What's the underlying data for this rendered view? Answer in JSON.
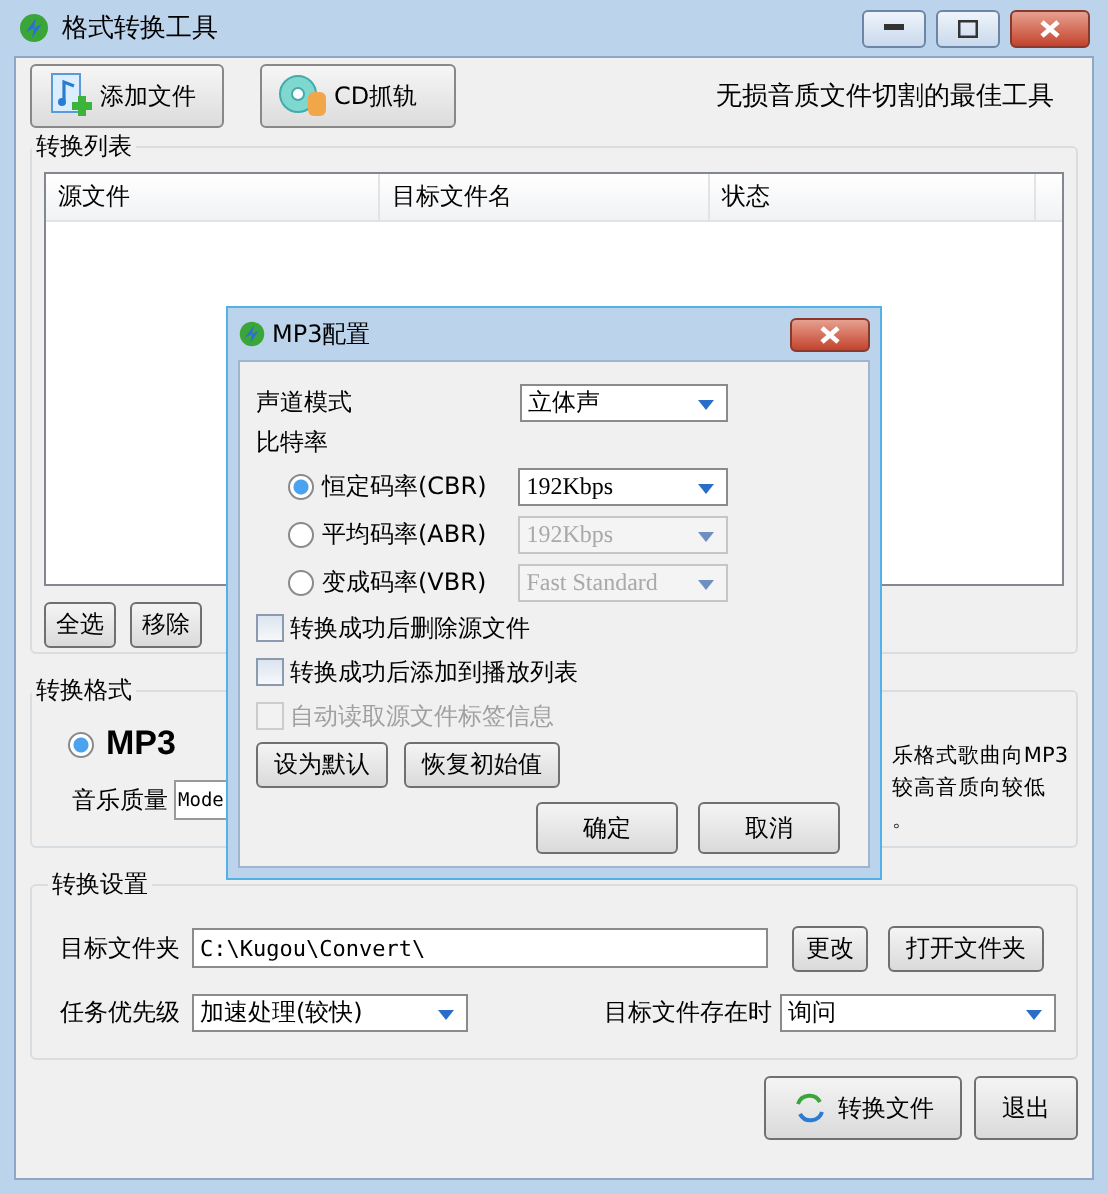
{
  "window": {
    "title": "格式转换工具"
  },
  "toolbar": {
    "buttons": [
      {
        "label": "添加文件",
        "kind": "add-file"
      },
      {
        "label": "CD抓轨",
        "kind": "cd"
      }
    ],
    "slogan": "无损音质文件切割的最佳工具"
  },
  "convert_list": {
    "title": "转换列表",
    "columns": [
      "源文件",
      "目标文件名",
      "状态"
    ],
    "buttons": [
      "全选",
      "移除"
    ]
  },
  "format": {
    "title": "转换格式",
    "options": [
      {
        "label": "MP3",
        "selected": true
      }
    ],
    "quality_label": "音乐质量",
    "quality_value": "Mode",
    "description": [
      "乐格式歌曲向MP3",
      "较高音质向较低",
      "。"
    ]
  },
  "settings": {
    "title": "转换设置",
    "folder_label": "目标文件夹",
    "folder_value": "C:\\Kugou\\Convert\\",
    "folder_buttons": [
      "更改",
      "打开文件夹"
    ],
    "priority_label": "任务优先级",
    "priority_value": "加速处理(较快)",
    "exists_label": "目标文件存在时",
    "exists_value": "询问"
  },
  "actions": [
    {
      "label": "转换文件",
      "kind": "convert"
    },
    {
      "label": "退出",
      "kind": "plain"
    }
  ],
  "dialog": {
    "title": "MP3配置",
    "channel_label": "声道模式",
    "channel_value": "立体声",
    "bitrate_label": "比特率",
    "modes": [
      {
        "label": "恒定码率(CBR)",
        "selected": true,
        "value": "192Kbps",
        "disabled": false
      },
      {
        "label": "平均码率(ABR)",
        "selected": false,
        "value": "192Kbps",
        "disabled": true
      },
      {
        "label": "变成码率(VBR)",
        "selected": false,
        "value": "Fast Standard",
        "disabled": true
      }
    ],
    "options": [
      {
        "label": "转换成功后删除源文件",
        "checked": false,
        "disabled": false
      },
      {
        "label": "转换成功后添加到播放列表",
        "checked": false,
        "disabled": false
      },
      {
        "label": "自动读取源文件标签信息",
        "checked": false,
        "disabled": true
      }
    ],
    "buttons": [
      "设为默认",
      "恢复初始值"
    ],
    "footer_buttons": [
      "确定",
      "取消"
    ]
  }
}
